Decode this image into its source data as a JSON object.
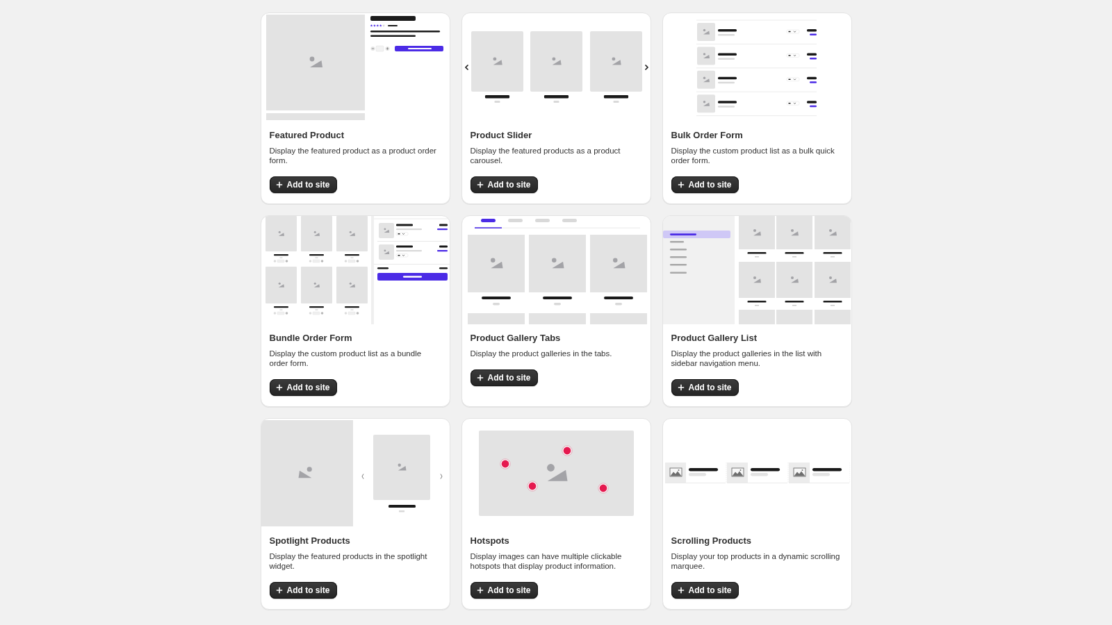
{
  "cards": [
    {
      "kind": "featured",
      "title": "Featured Product",
      "description": "Display the featured product as a product order form.",
      "button": "Add to site"
    },
    {
      "kind": "slider",
      "title": "Product Slider",
      "description": "Display the featured products as a product carousel.",
      "button": "Add to site"
    },
    {
      "kind": "bulk",
      "title": "Bulk Order Form",
      "description": "Display the custom product list as a bulk quick order form.",
      "button": "Add to site"
    },
    {
      "kind": "bundle",
      "title": "Bundle Order Form",
      "description": "Display the custom product list as a bundle order form.",
      "button": "Add to site"
    },
    {
      "kind": "tabs",
      "title": "Product Gallery Tabs",
      "description": "Display the product galleries in the tabs.",
      "button": "Add to site"
    },
    {
      "kind": "list",
      "title": "Product Gallery List",
      "description": "Display the product galleries in the list with sidebar navigation menu.",
      "button": "Add to site"
    },
    {
      "kind": "spotlight",
      "title": "Spotlight Products",
      "description": "Display the featured products in the spotlight widget.",
      "button": "Add to site"
    },
    {
      "kind": "hotspots",
      "title": "Hotspots",
      "description": "Display images can have multiple clickable hotspots that display product information.",
      "button": "Add to site"
    },
    {
      "kind": "scrolling",
      "title": "Scrolling Products",
      "description": "Display your top products in a dynamic scrolling marquee.",
      "button": "Add to site"
    }
  ]
}
